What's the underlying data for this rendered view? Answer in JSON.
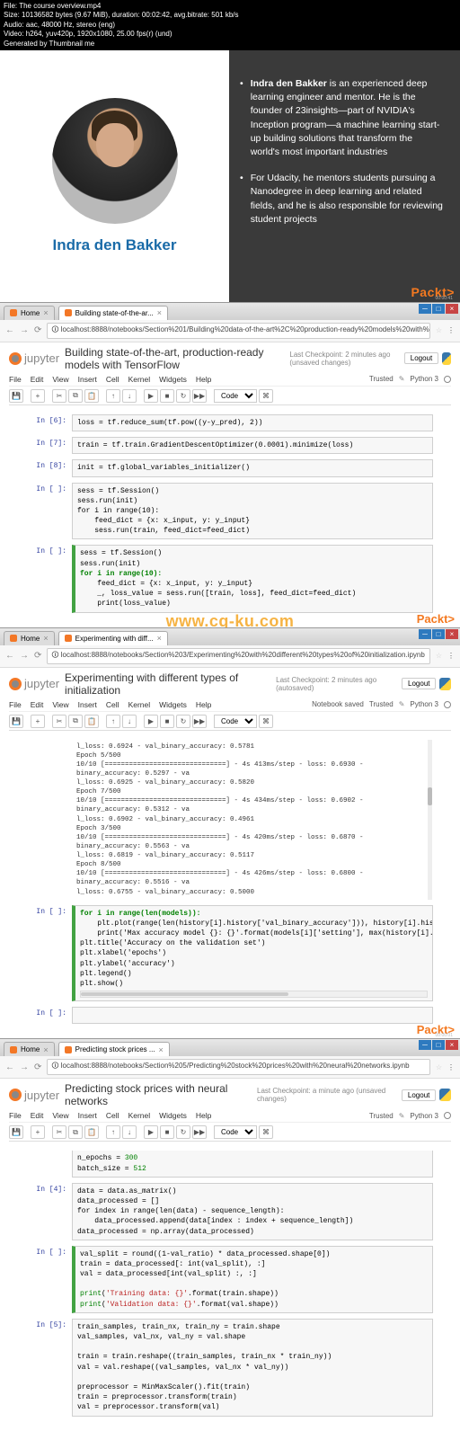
{
  "meta": {
    "l1": "File: The course overview.mp4",
    "l2": "Size: 10136582 bytes (9.67 MiB), duration: 00:02:42, avg.bitrate: 501 kb/s",
    "l3": "Audio: aac, 48000 Hz, stereo (eng)",
    "l4": "Video: h264, yuv420p, 1920x1080, 25.00 fps(r) (und)",
    "l5": "Generated by Thumbnail me"
  },
  "slide": {
    "name": "Indra den Bakker",
    "b1_strong": "Indra den Bakker",
    "b1": " is an experienced deep learning engineer and mentor. He is the founder of 23insights—part of NVIDIA's Inception program—a machine learning start-up building solutions that transform the world's most important industries",
    "b2": "For Udacity, he mentors students pursuing a Nanodegree in deep learning and related fields, and he is also responsible for reviewing student projects",
    "packt": "Packt>",
    "timestamp": "00:00:41"
  },
  "watermark": "www.cg-ku.com",
  "menus": {
    "file": "File",
    "edit": "Edit",
    "view": "View",
    "insert": "Insert",
    "cell": "Cell",
    "kernel": "Kernel",
    "widgets": "Widgets",
    "help": "Help"
  },
  "toolbar": {
    "save": "💾",
    "add": "+",
    "cut": "✂",
    "copy": "⧉",
    "paste": "📋",
    "up": "↑",
    "down": "↓",
    "run": "▶",
    "stop": "■",
    "restart": "↻",
    "fwd": "▶▶",
    "celltype": "Code",
    "cmd": "⌘"
  },
  "nb1": {
    "tab_home": "Home",
    "tab_title": "Building state-of-the-ar...",
    "url": "localhost:8888/notebooks/Section%201/Building%20data-of-the-art%2C%20production-ready%20models%20with%20TensorFlow.ipynb",
    "logo": "jupyter",
    "title": "Building state-of-the-art, production-ready models with TensorFlow",
    "checkpoint": "Last Checkpoint: 2 minutes ago (unsaved changes)",
    "logout": "Logout",
    "trusted": "Trusted",
    "kernel": "Python 3",
    "p6": "In [6]:",
    "c6": "loss = tf.reduce_sum(tf.pow((y-y_pred), 2))",
    "p7": "In [7]:",
    "c7": "train = tf.train.GradientDescentOptimizer(0.0001).minimize(loss)",
    "p8": "In [8]:",
    "c8": "init = tf.global_variables_initializer()",
    "pE1": "In [ ]:",
    "cE1": "sess = tf.Session()\nsess.run(init)\nfor i in range(10):\n    feed_dict = {x: x_input, y: y_input}\n    sess.run(train, feed_dict=feed_dict)",
    "pE2": "In [ ]:",
    "cE2_l1": "sess = tf.Session()",
    "cE2_l2": "sess.run(init)",
    "cE2_l3": "for i in range(10):",
    "cE2_l4": "    feed_dict = {x: x_input, y: y_input}",
    "cE2_l5": "    _, loss_value = sess.run([train, loss], feed_dict=feed_dict)",
    "cE2_l6": "    print(loss_value)"
  },
  "nb2": {
    "tab_home": "Home",
    "tab_title": "Experimenting with diff...",
    "url": "localhost:8888/notebooks/Section%203/Experimenting%20with%20different%20types%20of%20initialization.ipynb",
    "logo": "jupyter",
    "title": "Experimenting with different types of initialization",
    "checkpoint": "Last Checkpoint: 2 minutes ago (autosaved)",
    "logout": "Logout",
    "nbsaved": "Notebook saved",
    "trusted": "Trusted",
    "kernel": "Python 3",
    "out": "l_loss: 0.6924 - val_binary_accuracy: 0.5781\nEpoch 5/500\n10/10 [==============================] - 4s 413ms/step - loss: 0.6930 - binary_accuracy: 0.5297 - va\nl_loss: 0.6925 - val_binary_accuracy: 0.5820\nEpoch 7/500\n10/10 [==============================] - 4s 434ms/step - loss: 0.6902 - binary_accuracy: 0.5312 - va\nl_loss: 0.6902 - val_binary_accuracy: 0.4961\nEpoch 3/500\n10/10 [==============================] - 4s 420ms/step - loss: 0.6870 - binary_accuracy: 0.5563 - va\nl_loss: 0.6819 - val_binary_accuracy: 0.5117\nEpoch 8/500\n10/10 [==============================] - 4s 426ms/step - loss: 0.6800 - binary_accuracy: 0.5516 - va\nl_loss: 0.6755 - val_binary_accuracy: 0.5000",
    "pE": "In [ ]:",
    "cE_l1": "for i in range(len(models)):",
    "cE_l2": "    plt.plot(range(len(history[i].history['val_binary_accuracy'])), history[i].history['val_binary_accu",
    "cE_l3": "    print('Max accuracy model {}: {}'.format(models[i]['setting'], max(history[i].history['val_binary_a",
    "cE_l4": "plt.title('Accuracy on the validation set')",
    "cE_l5": "plt.xlabel('epochs')",
    "cE_l6": "plt.ylabel('accuracy')",
    "cE_l7": "plt.legend()",
    "cE_l8": "plt.show()",
    "pE2": "In [ ]:"
  },
  "nb3": {
    "tab_home": "Home",
    "tab_title": "Predicting stock prices ...",
    "url": "localhost:8888/notebooks/Section%205/Predicting%20stock%20prices%20with%20neural%20networks.ipynb",
    "logo": "jupyter",
    "title": "Predicting stock prices with neural networks",
    "checkpoint": "Last Checkpoint: a minute ago (unsaved changes)",
    "logout": "Logout",
    "trusted": "Trusted",
    "kernel": "Python 3",
    "pre_l1": "n_epochs = 300",
    "pre_l2": "batch_size = 512",
    "p4": "In [4]:",
    "c4": "data = data.as_matrix()\ndata_processed = []\nfor index in range(len(data) - sequence_length):\n    data_processed.append(data[index : index + sequence_length])\ndata_processed = np.array(data_processed)",
    "pE": "In [ ]:",
    "cE_l1": "val_split = round((1-val_ratio) * data_processed.shape[0])",
    "cE_l2": "train = data_processed[: int(val_split), :]",
    "cE_l3": "val = data_processed[int(val_split) :, :]",
    "cE_l4": "",
    "cE_l5": "print('Training data: {}'.format(train.shape))",
    "cE_l6": "print('Validation data: {}'.format(val.shape))",
    "p5": "In [5]:",
    "c5": "train_samples, train_nx, train_ny = train.shape\nval_samples, val_nx, val_ny = val.shape\n\ntrain = train.reshape((train_samples, train_nx * train_ny))\nval = val.reshape((val_samples, val_nx * val_ny))\n\npreprocessor = MinMaxScaler().fit(train)\ntrain = preprocessor.transform(train)\nval = preprocessor.transform(val)"
  },
  "packt_label": "Packt>"
}
